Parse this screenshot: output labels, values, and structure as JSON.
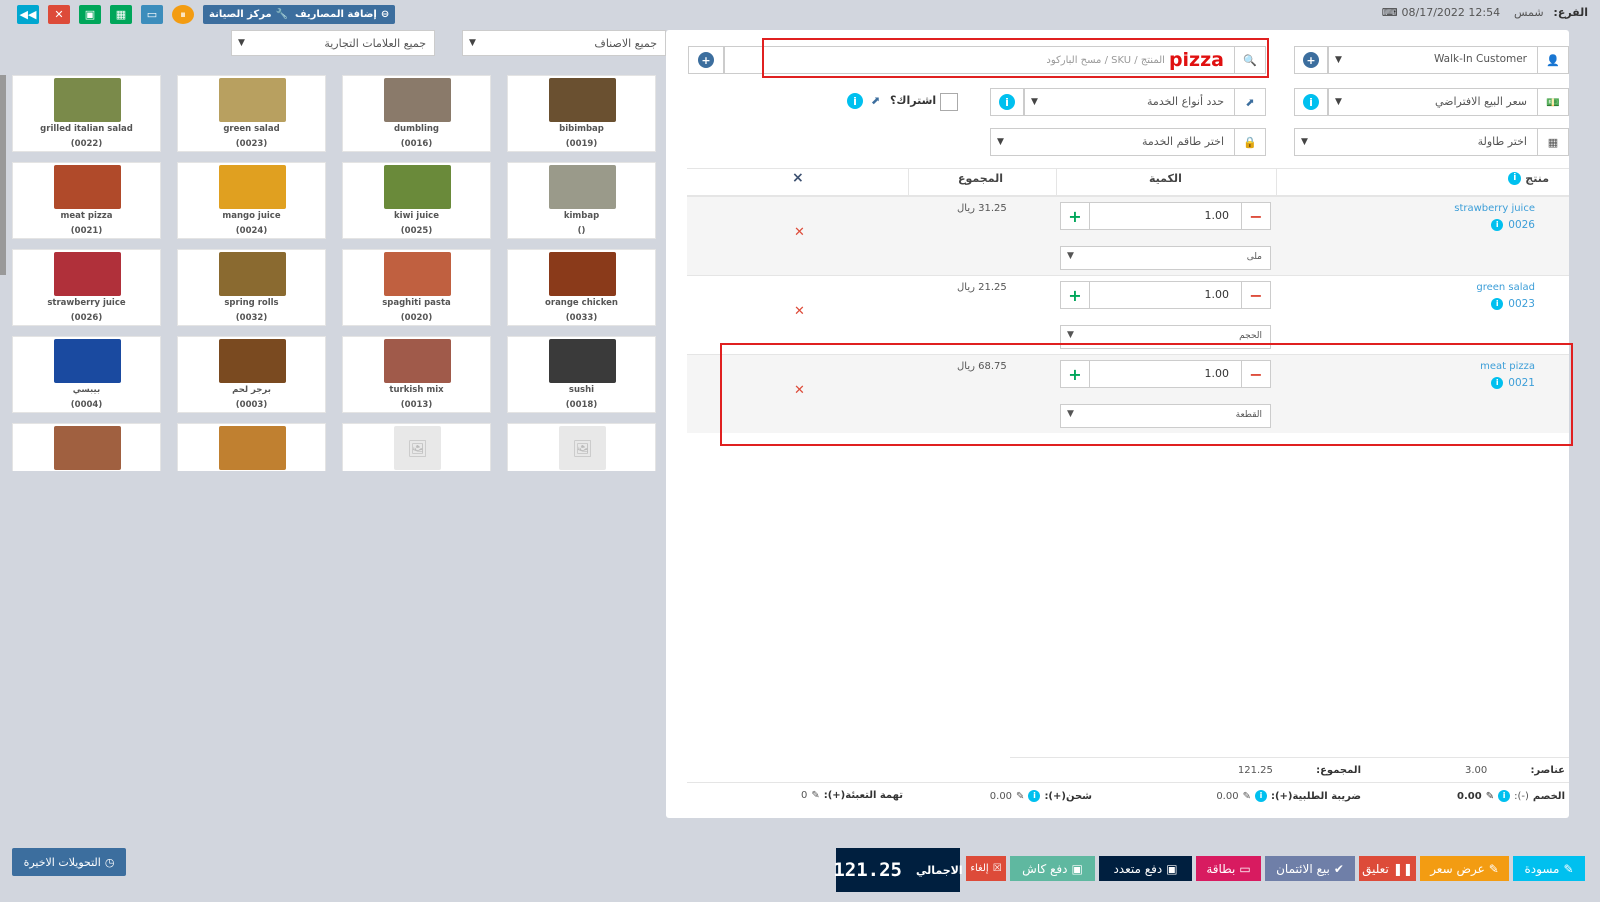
{
  "topbar": {
    "expenses_label": "إضافة المصاريف",
    "maintenance_label": "مركز الصيانة",
    "branch_label": "الفرع:",
    "branch_value": "شمس",
    "datetime": "08/17/2022 12:54"
  },
  "filters": {
    "categories": "جميع الاصناف",
    "brands": "جميع العلامات التجارية"
  },
  "products": [
    {
      "name": "grilled italian salad",
      "sku": "(0022)",
      "icon": "salad-photo",
      "color": "#7a8a4a"
    },
    {
      "name": "green salad",
      "sku": "(0023)",
      "icon": "salad-photo",
      "color": "#b8a060"
    },
    {
      "name": "dumbling",
      "sku": "(0016)",
      "icon": "dumpling-photo",
      "color": "#8a7a6a"
    },
    {
      "name": "bibimbap",
      "sku": "(0019)",
      "icon": "bibimbap-photo",
      "color": "#6a5030"
    },
    {
      "name": "meat pizza",
      "sku": "(0021)",
      "icon": "pizza-photo",
      "color": "#b04a2a"
    },
    {
      "name": "mango juice",
      "sku": "(0024)",
      "icon": "juice-photo",
      "color": "#e0a020"
    },
    {
      "name": "kiwi juice",
      "sku": "(0025)",
      "icon": "juice-photo",
      "color": "#6a8a3a"
    },
    {
      "name": "kimbap",
      "sku": "()",
      "icon": "kimbap-photo",
      "color": "#9a9a8a"
    },
    {
      "name": "strawberry juice",
      "sku": "(0026)",
      "icon": "juice-photo",
      "color": "#b0303a"
    },
    {
      "name": "spring rolls",
      "sku": "(0032)",
      "icon": "rolls-photo",
      "color": "#8a6a30"
    },
    {
      "name": "spaghiti pasta",
      "sku": "(0020)",
      "icon": "pasta-photo",
      "color": "#c06040"
    },
    {
      "name": "orange chicken",
      "sku": "(0033)",
      "icon": "chicken-photo",
      "color": "#8a3a1a"
    },
    {
      "name": "بيبسي",
      "sku": "(0004)",
      "icon": "pepsi-photo",
      "color": "#1a4aa0"
    },
    {
      "name": "برجر لحم",
      "sku": "(0003)",
      "icon": "burger-photo",
      "color": "#7a4a20"
    },
    {
      "name": "turkish mix",
      "sku": "(0013)",
      "icon": "mix-photo",
      "color": "#a05a4a"
    },
    {
      "name": "sushi",
      "sku": "(0018)",
      "icon": "sushi-photo",
      "color": "#3a3a3a"
    },
    {
      "name": "",
      "sku": "",
      "icon": "pide-photo",
      "color": "#a06040"
    },
    {
      "name": "",
      "sku": "",
      "icon": "pizza-photo",
      "color": "#c08030"
    },
    {
      "name": "",
      "sku": "",
      "icon": "image-placeholder-icon",
      "color": "#e8e8e8"
    },
    {
      "name": "",
      "sku": "",
      "icon": "image-placeholder-icon",
      "color": "#e8e8e8"
    }
  ],
  "recent_label": "التحويلات الاخيرة",
  "pos": {
    "customer": "Walk-In Customer",
    "search_value": "pizza",
    "search_placeholder": "المنتج / SKU / مسح الباركود",
    "price_group": "سعر البيع الافتراضي",
    "service_types": "حدد أنواع الخدمة",
    "subscription": "اشتراك؟",
    "table": "اختر طاولة",
    "service_staff": "اختر طاقم الخدمة"
  },
  "table_head": {
    "product": "منتج",
    "qty": "الكمية",
    "subtotal": "المجموع",
    "remove": "×"
  },
  "cart": [
    {
      "name": "strawberry juice",
      "sku": "0026",
      "qty": "1.00",
      "subtotal": "31.25 ريال",
      "unit": "ملى"
    },
    {
      "name": "green salad",
      "sku": "0023",
      "qty": "1.00",
      "subtotal": "21.25 ريال",
      "unit": "الحجم"
    },
    {
      "name": "meat pizza",
      "sku": "0021",
      "qty": "1.00",
      "subtotal": "68.75 ريال",
      "unit": "القطعة"
    }
  ],
  "totals": {
    "items_label": "عناصر:",
    "items_value": "3.00",
    "subtotal_label": "المجموع:",
    "subtotal_value": "121.25",
    "discount_label": "الخصم",
    "discount_sign": "(-):",
    "discount_value": "0.00",
    "tax_label": "ضريبة الطلبية(+):",
    "tax_value": "0.00",
    "shipping_label": "شحن(+):",
    "shipping_value": "0.00",
    "packing_label": "تهمة التعبئة(+):",
    "packing_value": "0"
  },
  "footer": {
    "draft": "مسودة",
    "quotation": "عرض سعر",
    "suspend": "تعليق",
    "credit_sale": "بيع الائتمان",
    "card": "بطاقة",
    "multiple_pay": "دفع متعدد",
    "cash": "دفع كاش",
    "cancel": "إلغاء",
    "total_label": "الاجمالي",
    "total_value": "121.25"
  }
}
